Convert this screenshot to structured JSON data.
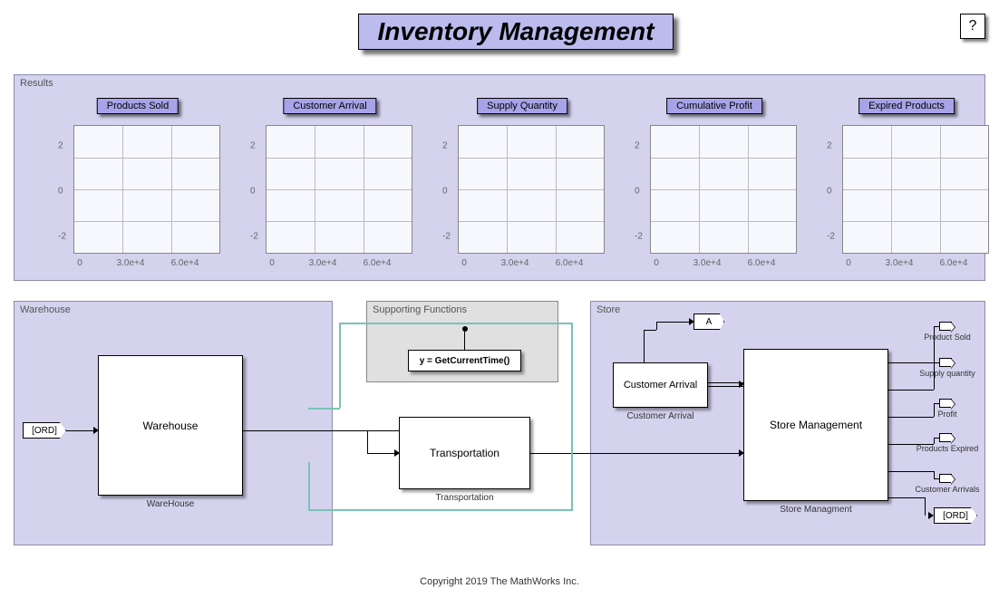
{
  "title": "Inventory Management",
  "help": "?",
  "copyright": "Copyright 2019 The MathWorks Inc.",
  "panels": {
    "results": "Results",
    "warehouse": "Warehouse",
    "support": "Supporting Functions",
    "store": "Store"
  },
  "charts": {
    "titles": [
      "Products Sold",
      "Customer Arrival",
      "Supply Quantity",
      "Cumulative Profit",
      "Expired Products"
    ],
    "yticks": [
      "2",
      "0",
      "-2"
    ],
    "xticks": [
      "0",
      "3.0e+4",
      "6.0e+4"
    ]
  },
  "blocks": {
    "ord_in": "[ORD]",
    "warehouse": "Warehouse",
    "warehouse_sub": "WareHouse",
    "func": "y = GetCurrentTime()",
    "transport": "Transportation",
    "transport_sub": "Transportation",
    "cust": "Customer Arrival",
    "cust_sub": "Customer Arrival",
    "storemgmt": "Store Management",
    "storemgmt_sub": "Store Managment",
    "goto_a": "A",
    "ord_out": "[ORD]"
  },
  "outputs": [
    "Product Sold",
    "Supply quantity",
    "Profit",
    "Products Expired",
    "Customer Arrivals"
  ],
  "chart_data": [
    {
      "type": "line",
      "title": "Products Sold",
      "x": [],
      "values": [],
      "xlim": [
        0,
        60000
      ],
      "ylim": [
        -3,
        3
      ],
      "xticks": [
        0,
        30000,
        60000
      ],
      "yticks": [
        -2,
        0,
        2
      ]
    },
    {
      "type": "line",
      "title": "Customer Arrival",
      "x": [],
      "values": [],
      "xlim": [
        0,
        60000
      ],
      "ylim": [
        -3,
        3
      ],
      "xticks": [
        0,
        30000,
        60000
      ],
      "yticks": [
        -2,
        0,
        2
      ]
    },
    {
      "type": "line",
      "title": "Supply Quantity",
      "x": [],
      "values": [],
      "xlim": [
        0,
        60000
      ],
      "ylim": [
        -3,
        3
      ],
      "xticks": [
        0,
        30000,
        60000
      ],
      "yticks": [
        -2,
        0,
        2
      ]
    },
    {
      "type": "line",
      "title": "Cumulative Profit",
      "x": [],
      "values": [],
      "xlim": [
        0,
        60000
      ],
      "ylim": [
        -3,
        3
      ],
      "xticks": [
        0,
        30000,
        60000
      ],
      "yticks": [
        -2,
        0,
        2
      ]
    },
    {
      "type": "line",
      "title": "Expired Products",
      "x": [],
      "values": [],
      "xlim": [
        0,
        60000
      ],
      "ylim": [
        -3,
        3
      ],
      "xticks": [
        0,
        30000,
        60000
      ],
      "yticks": [
        -2,
        0,
        2
      ]
    }
  ]
}
